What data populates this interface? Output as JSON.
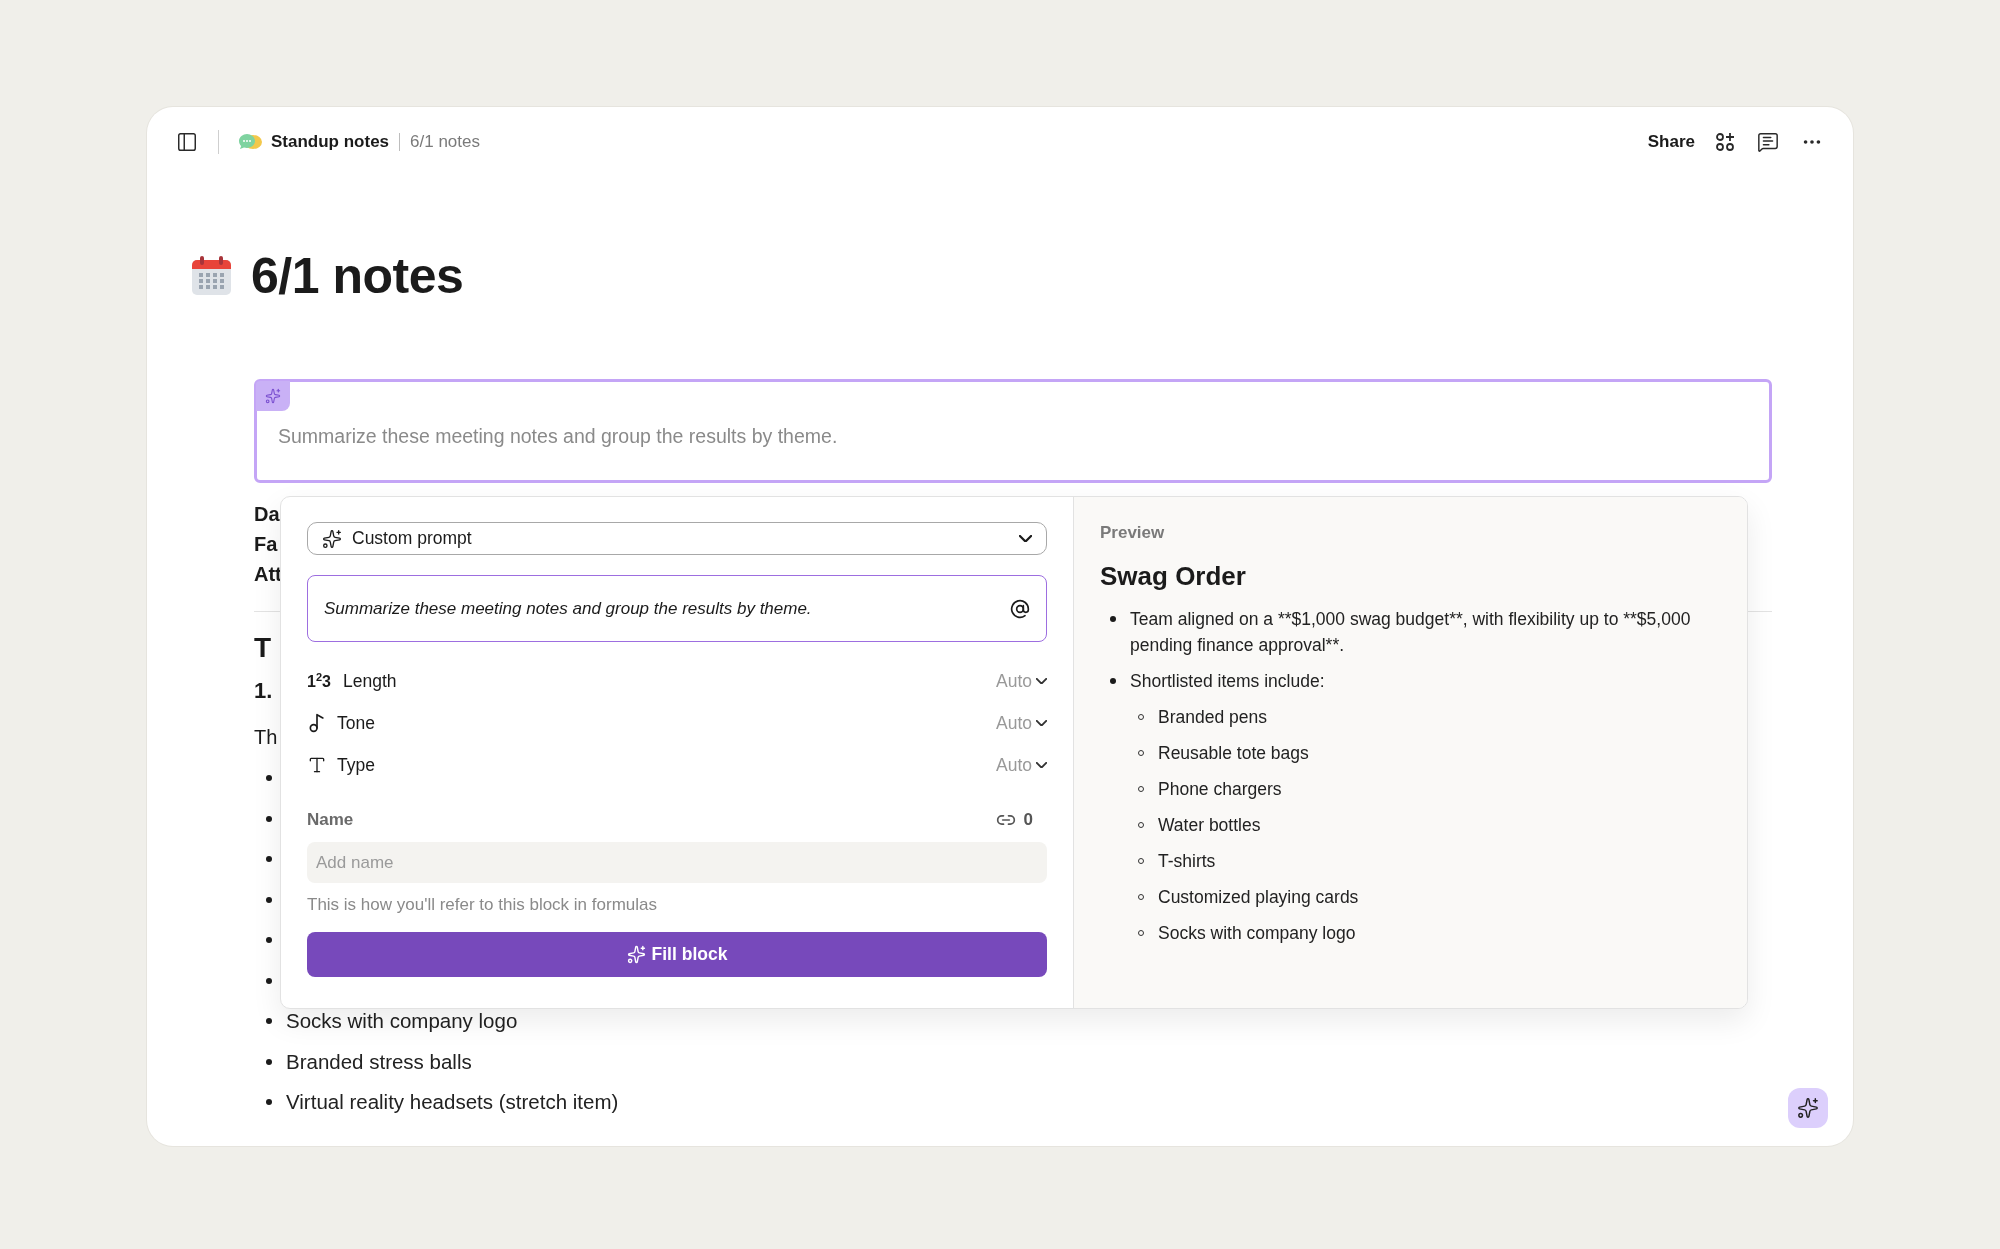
{
  "topbar": {
    "breadcrumb": [
      "Standup notes",
      "6/1 notes"
    ],
    "share": "Share"
  },
  "page": {
    "title": "6/1 notes"
  },
  "ai_block": {
    "placeholder": "Summarize these meeting notes and group the results by theme."
  },
  "doc": {
    "meta": [
      "Da",
      "Fa",
      "Att"
    ],
    "heading": "T",
    "subheading": "1.",
    "paragraph": "Th",
    "bullets": [
      {
        "kind": "covered"
      },
      {
        "kind": "covered"
      },
      {
        "kind": "covered"
      },
      {
        "kind": "covered"
      },
      {
        "kind": "covered"
      },
      {
        "kind": "covered"
      },
      {
        "kind": "text",
        "text": "Socks with company logo"
      },
      {
        "kind": "text",
        "text": "Branded stress balls"
      },
      {
        "kind": "text",
        "text": "Virtual reality headsets (stretch item)"
      }
    ]
  },
  "popup": {
    "mode": {
      "label": "Custom prompt"
    },
    "prompt": {
      "value": "Summarize these meeting notes and group the results by theme."
    },
    "options": [
      {
        "kind": "length",
        "glyph": "1$^{2}$3",
        "label": "Length",
        "value": "Auto"
      },
      {
        "kind": "tone",
        "label": "Tone",
        "value": "Auto"
      },
      {
        "kind": "type",
        "label": "Type",
        "value": "Auto"
      }
    ],
    "name": {
      "label": "Name",
      "ref_count": "0",
      "placeholder": "Add name",
      "hint": "This is how you'll refer to this block in formulas"
    },
    "button": "Fill block",
    "preview": {
      "label": "Preview",
      "title": "Swag Order",
      "items": [
        {
          "text": "Team aligned on a **$1,000 swag budget**, with flexibility up to **$5,000 pending finance approval**."
        },
        {
          "text": "Shortlisted items include:",
          "children": [
            {
              "text": "Branded pens"
            },
            {
              "text": "Reusable tote bags"
            },
            {
              "text": "Phone chargers"
            },
            {
              "text": "Water bottles"
            },
            {
              "text": "T-shirts"
            },
            {
              "text": "Customized playing cards"
            },
            {
              "text": "Socks with company logo"
            }
          ]
        }
      ]
    }
  }
}
